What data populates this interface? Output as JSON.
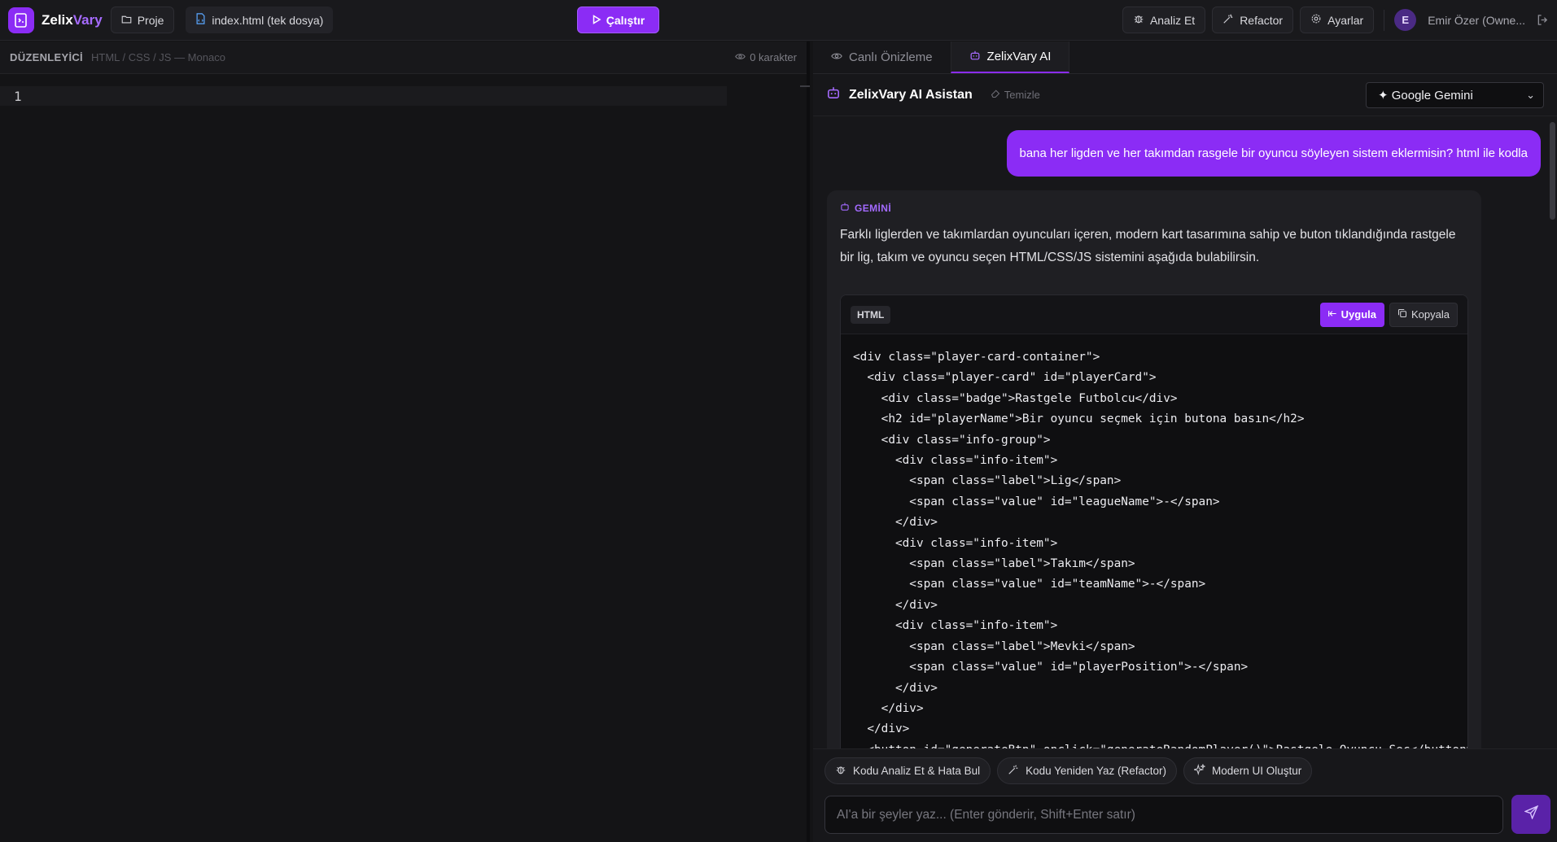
{
  "app": {
    "brand_a": "Zelix",
    "brand_b": "Vary"
  },
  "topbar": {
    "project_label": "Proje",
    "file_label": "index.html (tek dosya)",
    "run_label": "Çalıştır",
    "analyze_label": "Analiz Et",
    "refactor_label": "Refactor",
    "settings_label": "Ayarlar",
    "avatar_initial": "E",
    "user_name": "Emir Özer (Owne..."
  },
  "editor": {
    "title": "DÜZENLEYİCİ",
    "subtitle": "HTML / CSS / JS — Monaco",
    "char_count": "0 karakter",
    "line_number": "1"
  },
  "panel": {
    "tabs": [
      {
        "label": "Canlı Önizleme",
        "active": false
      },
      {
        "label": "ZelixVary AI",
        "active": true
      }
    ],
    "ai_title": "ZelixVary AI Asistan",
    "clear_label": "Temizle",
    "model_selected": "✦ Google Gemini"
  },
  "chat": {
    "user_message": "bana her ligden ve her takımdan rasgele bir oyuncu söyleyen sistem eklermisin? html ile kodla",
    "bot_label": "GEMİNİ",
    "bot_text": "Farklı liglerden ve takımlardan oyuncuları içeren, modern kart tasarımına sahip ve buton tıklandığında rastgele bir lig, takım ve oyuncu seçen HTML/CSS/JS sistemini aşağıda bulabilirsin.",
    "code_lang": "HTML",
    "apply_label": "Uygula",
    "copy_label": "Kopyala",
    "code_lines": [
      "<div class=\"player-card-container\">",
      "  <div class=\"player-card\" id=\"playerCard\">",
      "    <div class=\"badge\">Rastgele Futbolcu</div>",
      "    <h2 id=\"playerName\">Bir oyuncu seçmek için butona basın</h2>",
      "    <div class=\"info-group\">",
      "      <div class=\"info-item\">",
      "        <span class=\"label\">Lig</span>",
      "        <span class=\"value\" id=\"leagueName\">-</span>",
      "      </div>",
      "      <div class=\"info-item\">",
      "        <span class=\"label\">Takım</span>",
      "        <span class=\"value\" id=\"teamName\">-</span>",
      "      </div>",
      "      <div class=\"info-item\">",
      "        <span class=\"label\">Mevki</span>",
      "        <span class=\"value\" id=\"playerPosition\">-</span>",
      "      </div>",
      "    </div>",
      "  </div>",
      "  <button id=\"generateBtn\" onclick=\"generateRandomPlayer()\">Rastgele Oyuncu Seç</button>"
    ]
  },
  "suggestions": [
    {
      "label": "Kodu Analiz Et & Hata Bul",
      "icon": "bug-icon"
    },
    {
      "label": "Kodu Yeniden Yaz (Refactor)",
      "icon": "wand-icon"
    },
    {
      "label": "Modern UI Oluştur",
      "icon": "sparkles-icon"
    }
  ],
  "composer": {
    "placeholder": "AI'a bir şeyler yaz... (Enter gönderir, Shift+Enter satır)"
  },
  "colors": {
    "accent": "#8b2cf5",
    "background": "#141416"
  }
}
